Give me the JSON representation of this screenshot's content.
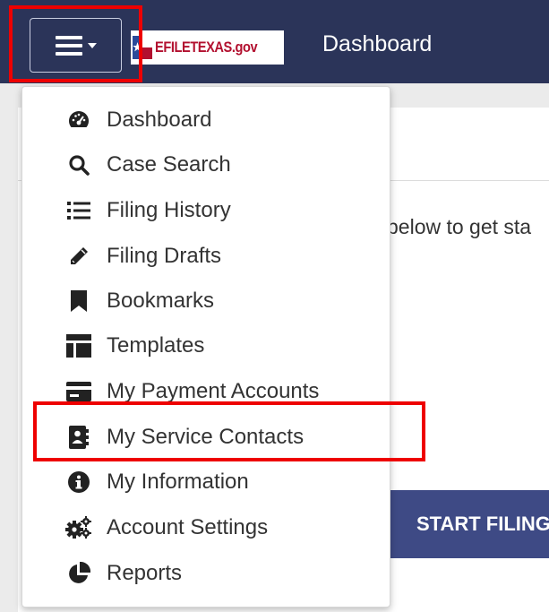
{
  "header": {
    "logo_text": "EFILETEXAS.gov",
    "title": "Dashboard",
    "menu_icon": "hamburger-caret-icon"
  },
  "page": {
    "intro_fragment": "below to get sta",
    "start_button": "START FILING"
  },
  "menu": {
    "items": [
      {
        "label": "Dashboard",
        "icon": "tachometer-icon"
      },
      {
        "label": "Case Search",
        "icon": "search-icon"
      },
      {
        "label": "Filing History",
        "icon": "list-icon"
      },
      {
        "label": "Filing Drafts",
        "icon": "pencil-icon"
      },
      {
        "label": "Bookmarks",
        "icon": "bookmark-icon"
      },
      {
        "label": "Templates",
        "icon": "template-icon"
      },
      {
        "label": "My Payment Accounts",
        "icon": "credit-card-icon"
      },
      {
        "label": "My Service Contacts",
        "icon": "address-book-icon"
      },
      {
        "label": "My Information",
        "icon": "info-circle-icon"
      },
      {
        "label": "Account Settings",
        "icon": "cogs-icon"
      },
      {
        "label": "Reports",
        "icon": "pie-chart-icon"
      }
    ]
  },
  "colors": {
    "navbar": "#2b3459",
    "button": "#3e4a85",
    "highlight": "#ee0000",
    "logo_red": "#b2102f"
  }
}
